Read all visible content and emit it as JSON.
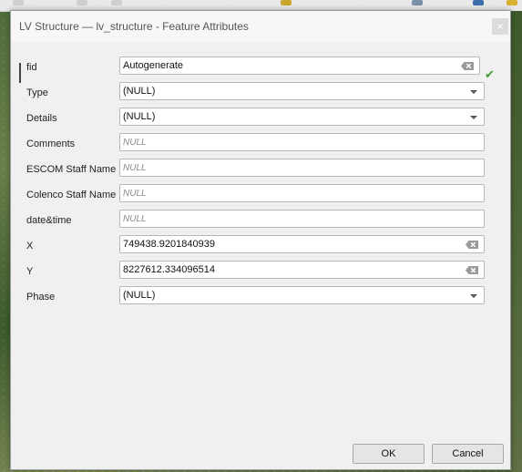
{
  "dialog": {
    "title": "LV Structure — lv_structure - Feature Attributes",
    "close_label": "×"
  },
  "fields": [
    {
      "label": "fid",
      "value": "Autogenerate",
      "kind": "text",
      "clearable": true
    },
    {
      "label": "Type",
      "value": "(NULL)",
      "kind": "dropdown"
    },
    {
      "label": "Details",
      "value": "(NULL)",
      "kind": "dropdown"
    },
    {
      "label": "Comments",
      "placeholder": "NULL",
      "kind": "text"
    },
    {
      "label": "ESCOM Staff Name",
      "placeholder": "NULL",
      "kind": "text"
    },
    {
      "label": "Colenco Staff Name",
      "placeholder": "NULL",
      "kind": "text"
    },
    {
      "label": "date&time",
      "placeholder": "NULL",
      "kind": "text"
    },
    {
      "label": "X",
      "value": "749438.9201840939",
      "kind": "text",
      "clearable": true
    },
    {
      "label": "Y",
      "value": "8227612.334096514",
      "kind": "text",
      "clearable": true
    },
    {
      "label": "Phase",
      "value": "(NULL)",
      "kind": "dropdown"
    }
  ],
  "validity_icon": "checkmark-icon",
  "validity_glyph": "✔",
  "buttons": {
    "ok": "OK",
    "cancel": "Cancel"
  }
}
